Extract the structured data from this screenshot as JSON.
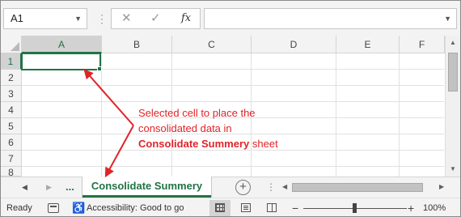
{
  "formula_bar": {
    "name_box": "A1",
    "cancel_icon": "✕",
    "enter_icon": "✓",
    "fx_label": "fx",
    "formula": ""
  },
  "columns": [
    "A",
    "B",
    "C",
    "D",
    "E",
    "F"
  ],
  "rows": [
    "1",
    "2",
    "3",
    "4",
    "5",
    "6",
    "7",
    "8"
  ],
  "selected_cell": "A1",
  "annotation": {
    "line1": "Selected cell to place the",
    "line2": "consolidated data in",
    "line3_bold": "Consolidate Summery",
    "line3_rest": " sheet",
    "color": "#e0242a"
  },
  "sheet_tabs": {
    "more": "...",
    "active_tab": "Consolidate Summery",
    "add_icon": "+"
  },
  "status_bar": {
    "ready": "Ready",
    "accessibility": "Accessibility: Good to go",
    "zoom_minus": "−",
    "zoom_plus": "+",
    "zoom": "100%"
  },
  "colors": {
    "accent": "#217346"
  }
}
